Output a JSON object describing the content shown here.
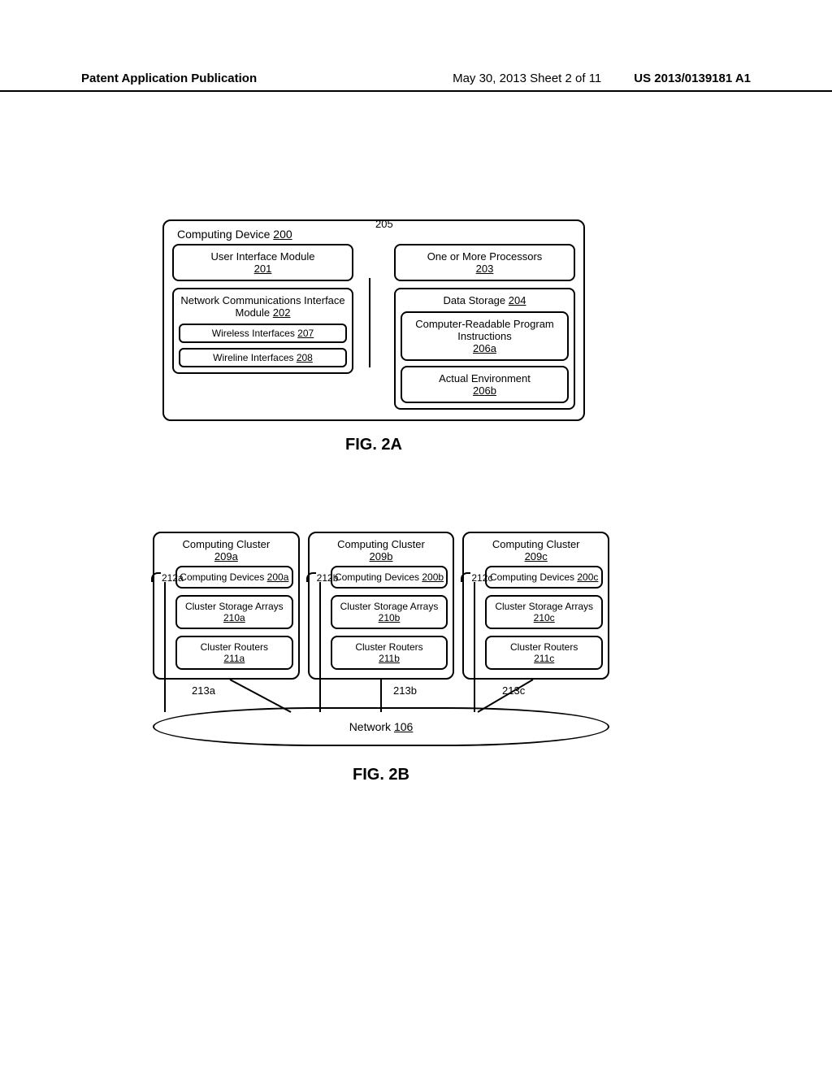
{
  "header": {
    "left": "Patent Application Publication",
    "mid": "May 30, 2013  Sheet 2 of 11",
    "right": "US 2013/0139181 A1"
  },
  "fig2a": {
    "caption": "FIG. 2A",
    "busRef": "205",
    "device": {
      "label": "Computing Device ",
      "ref": "200"
    },
    "ui": {
      "label": "User Interface Module",
      "ref": "201"
    },
    "netcom": {
      "label": "Network Communications Interface Module ",
      "ref": "202"
    },
    "wireless": {
      "label": "Wireless Interfaces ",
      "ref": "207"
    },
    "wireline": {
      "label": "Wireline Interfaces ",
      "ref": "208"
    },
    "proc": {
      "label": "One or More Processors",
      "ref": "203"
    },
    "ds": {
      "label": "Data Storage ",
      "ref": "204"
    },
    "cri": {
      "label": "Computer-Readable Program Instructions",
      "ref": "206a"
    },
    "env": {
      "label": "Actual Environment",
      "ref": "206b"
    }
  },
  "fig2b": {
    "caption": "FIG. 2B",
    "network": {
      "label": "Network ",
      "ref": "106"
    },
    "clusters": [
      {
        "title": "Computing Cluster",
        "tref": "209a",
        "bus": "212a",
        "link": "213a",
        "dev": {
          "l": "Computing Devices ",
          "r": "200a"
        },
        "sto": {
          "l": "Cluster Storage Arrays ",
          "r": "210a"
        },
        "rou": {
          "l": "Cluster Routers",
          "r": "211a"
        }
      },
      {
        "title": "Computing Cluster",
        "tref": "209b",
        "bus": "212b",
        "link": "213b",
        "dev": {
          "l": "Computing Devices ",
          "r": "200b"
        },
        "sto": {
          "l": "Cluster Storage Arrays ",
          "r": "210b"
        },
        "rou": {
          "l": "Cluster Routers",
          "r": "211b"
        }
      },
      {
        "title": "Computing Cluster",
        "tref": "209c",
        "bus": "212c",
        "link": "213c",
        "dev": {
          "l": "Computing Devices ",
          "r": "200c"
        },
        "sto": {
          "l": "Cluster Storage Arrays ",
          "r": "210c"
        },
        "rou": {
          "l": "Cluster Routers",
          "r": "211c"
        }
      }
    ]
  }
}
